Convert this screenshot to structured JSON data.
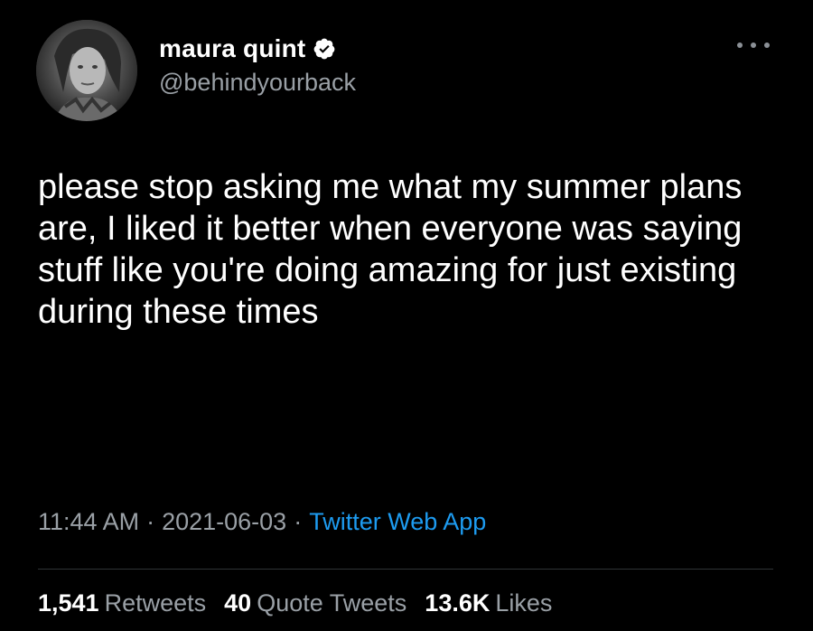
{
  "author": {
    "display_name": "maura quint",
    "handle": "@behindyourback",
    "verified": true
  },
  "tweet": {
    "text": "please stop asking me what my summer plans are, I liked it better when everyone was saying stuff like you're doing amazing for just existing during these times"
  },
  "meta": {
    "time": "11:44 AM",
    "separator": "·",
    "date": "2021-06-03",
    "source": "Twitter Web App"
  },
  "stats": {
    "retweets_count": "1,541",
    "retweets_label": "Retweets",
    "quotes_count": "40",
    "quotes_label": "Quote Tweets",
    "likes_count": "13.6K",
    "likes_label": "Likes"
  },
  "colors": {
    "background": "#000000",
    "link": "#1d9bf0",
    "muted": "#9aa0a6"
  },
  "icons": {
    "verified": "verified-badge-icon",
    "more": "more-options-icon"
  }
}
